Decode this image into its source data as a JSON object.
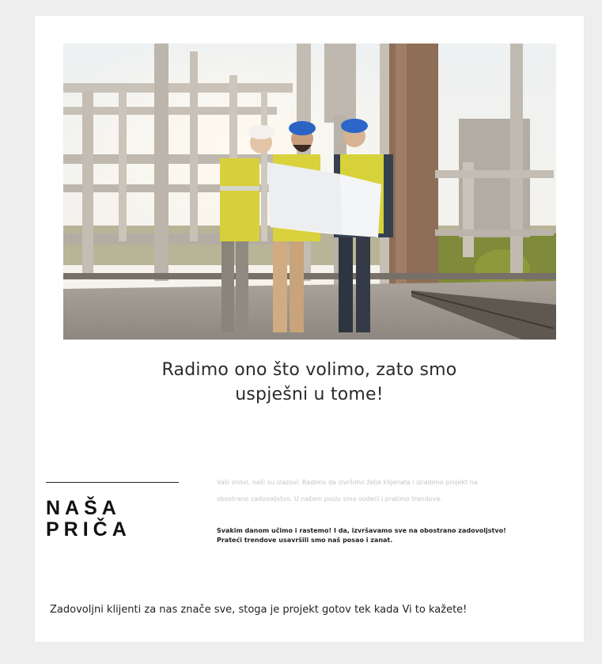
{
  "hero": {
    "image_name": "construction-engineers-photo"
  },
  "headline": {
    "line1": "Radimo ono što volimo, zato smo",
    "line2": "uspješni u tome!"
  },
  "story": {
    "title_line1": "NAŠA",
    "title_line2": "PRIČA",
    "light_text": "Vaši snovi, naši su izazovi. Radimo da izvršimo želje klijenata i izradimo projekt na obostrano zadovoljstvo. U našem poslu smo vodeći i pratimo trendove.",
    "bold_text": "Svakim danom učimo i rastemo! I da, izvršavamo sve na obostrano zadovoljstvo! Prateći trendove usavršili smo naš posao i zanat."
  },
  "footer": {
    "text": "Zadovoljni klijenti za nas znače sve, stoga je projekt gotov tek kada Vi to kažete!"
  },
  "colors": {
    "page_bg": "#eeeeee",
    "card_bg": "#ffffff",
    "text_dark": "#222222",
    "text_muted": "#c4c4c4"
  }
}
